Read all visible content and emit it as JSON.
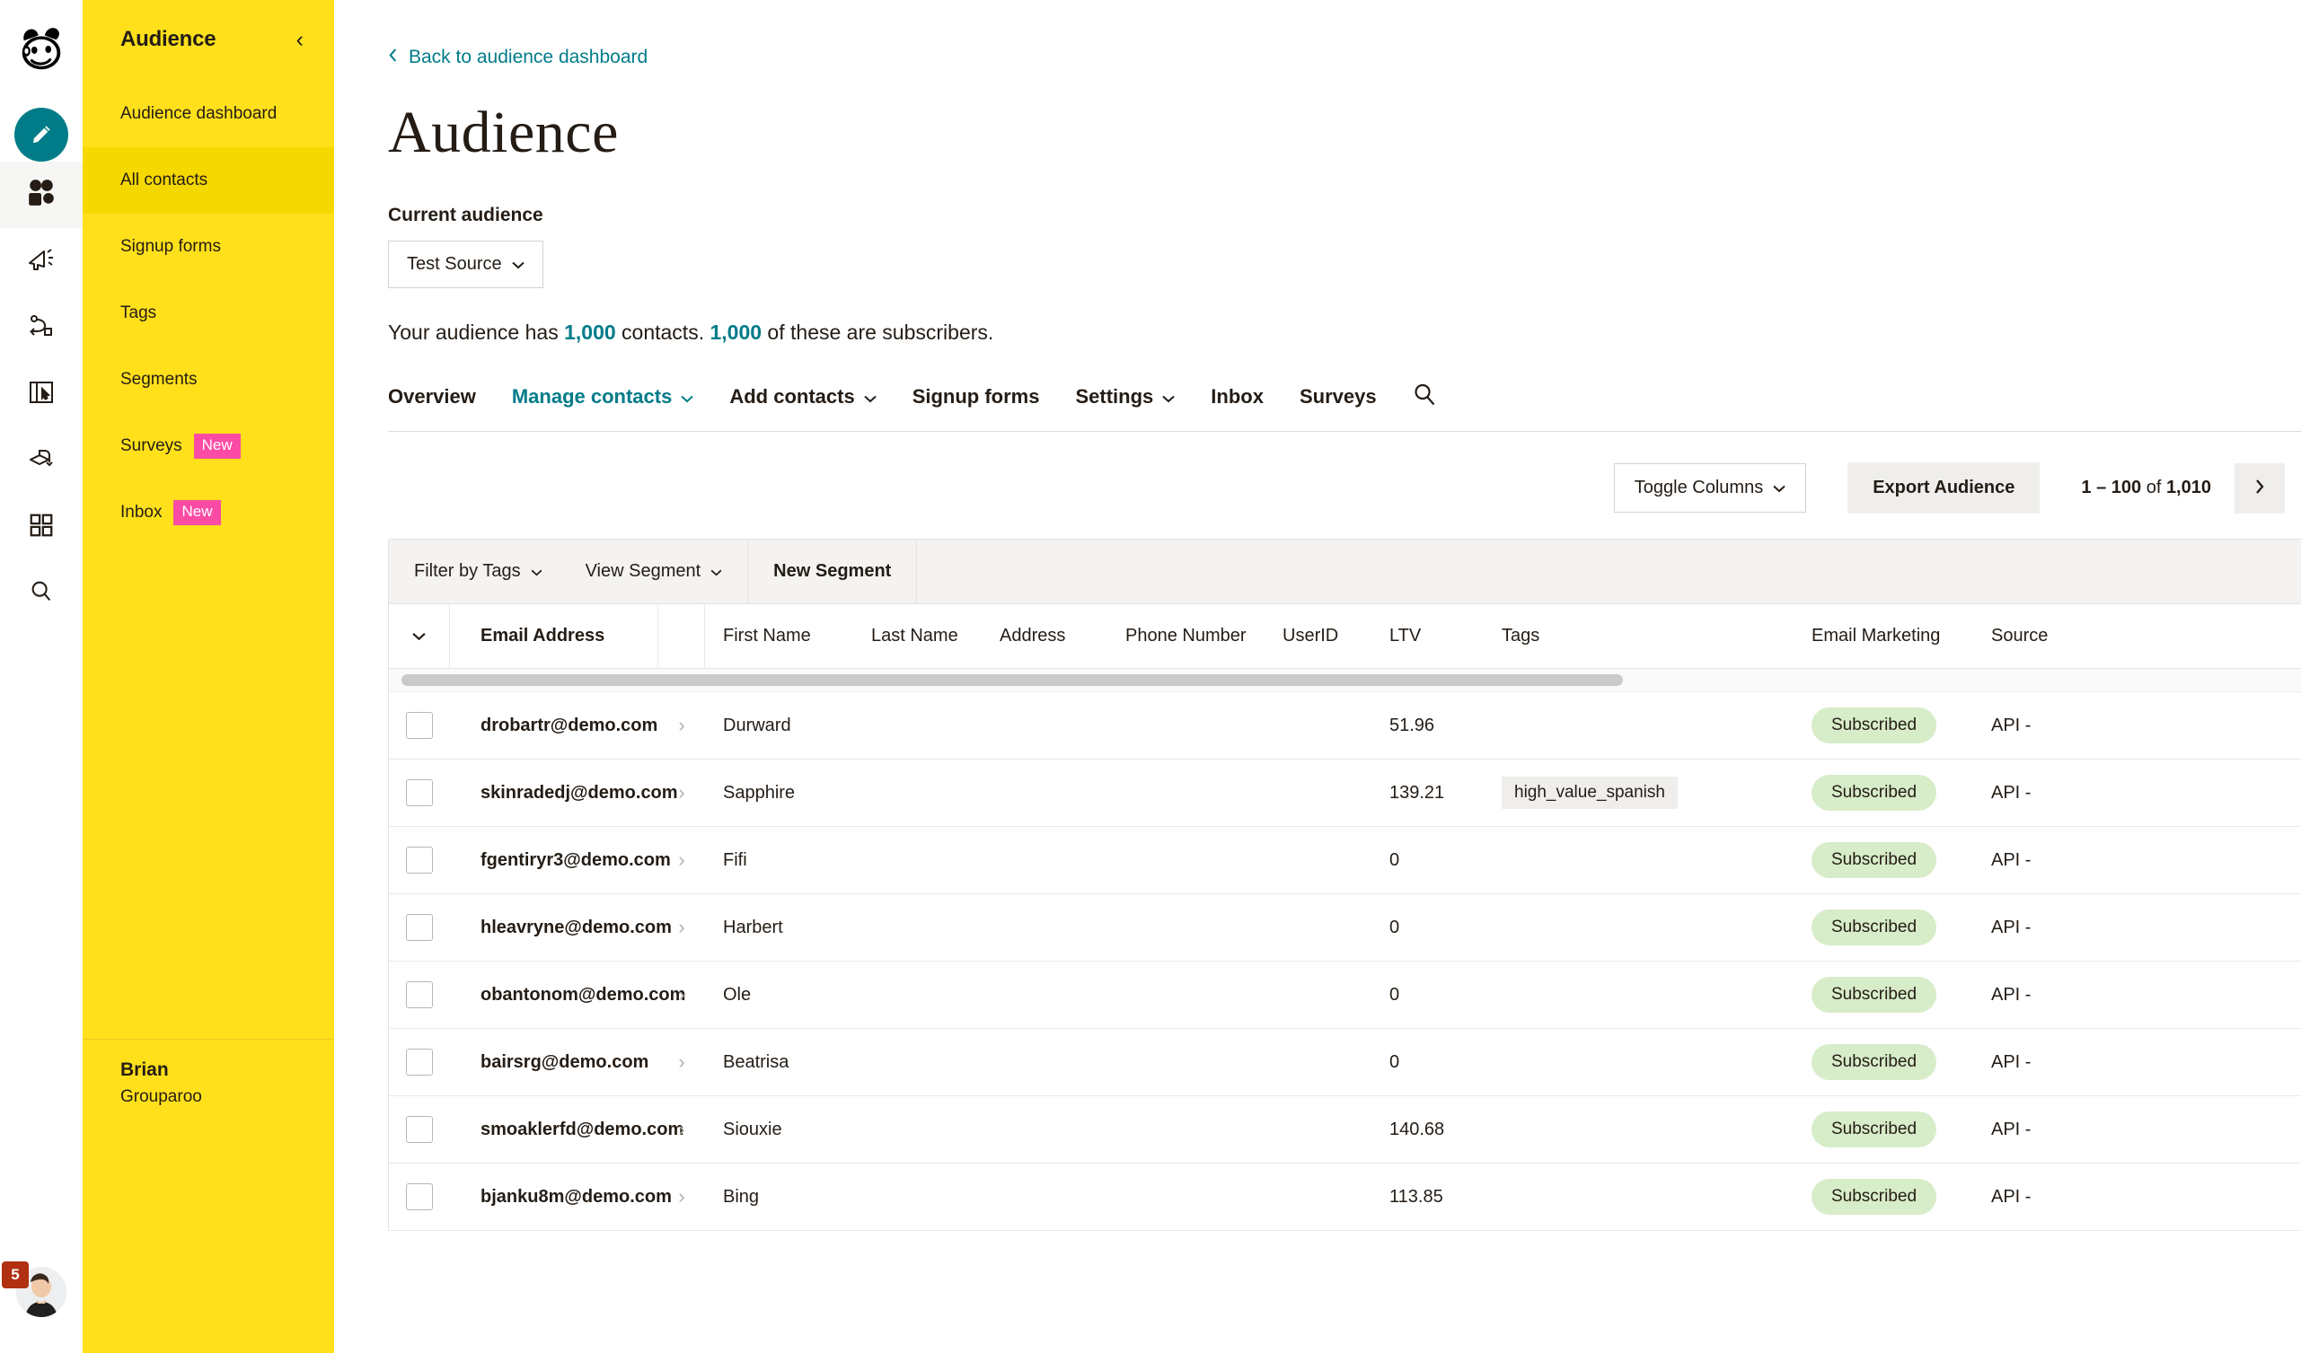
{
  "rail": {
    "logo_icon": "mailchimp-freddie-logo",
    "compose_icon": "pencil-icon",
    "items": [
      {
        "icon": "contacts-icon",
        "name": "all-contacts",
        "active": true
      },
      {
        "icon": "megaphone-icon",
        "name": "signup-forms",
        "active": false
      },
      {
        "icon": "journey-icon",
        "name": "tags",
        "active": false
      },
      {
        "icon": "segments-icon",
        "name": "segments",
        "active": false
      },
      {
        "icon": "surveys-icon",
        "name": "surveys",
        "active": false
      },
      {
        "icon": "grid-icon",
        "name": "inbox",
        "active": false
      },
      {
        "icon": "search-icon",
        "name": "search",
        "active": false
      }
    ],
    "avatar_badge": "5"
  },
  "nav": {
    "title": "Audience",
    "collapse_icon": "chevron-left-icon",
    "items": [
      {
        "label": "Audience dashboard",
        "badge": "",
        "active": false
      },
      {
        "label": "All contacts",
        "badge": "",
        "active": true
      },
      {
        "label": "Signup forms",
        "badge": "",
        "active": false
      },
      {
        "label": "Tags",
        "badge": "",
        "active": false
      },
      {
        "label": "Segments",
        "badge": "",
        "active": false
      },
      {
        "label": "Surveys",
        "badge": "New",
        "active": false
      },
      {
        "label": "Inbox",
        "badge": "New",
        "active": false
      }
    ],
    "user": {
      "name": "Brian",
      "org": "Grouparoo"
    }
  },
  "main": {
    "back_link": "Back to audience dashboard",
    "back_icon": "chevron-left-icon",
    "page_title": "Audience",
    "current_audience_label": "Current audience",
    "source_select": {
      "value": "Test Source",
      "icon": "chevron-down-icon"
    },
    "stats": {
      "prefix": "Your audience has ",
      "contacts_count": "1,000",
      "middle": " contacts. ",
      "subscribers_count": "1,000",
      "suffix": " of these are subscribers."
    },
    "tabs": [
      {
        "label": "Overview",
        "caret": false,
        "active": false
      },
      {
        "label": "Manage contacts",
        "caret": true,
        "active": true
      },
      {
        "label": "Add contacts",
        "caret": true,
        "active": false
      },
      {
        "label": "Signup forms",
        "caret": false,
        "active": false
      },
      {
        "label": "Settings",
        "caret": true,
        "active": false
      },
      {
        "label": "Inbox",
        "caret": false,
        "active": false
      },
      {
        "label": "Surveys",
        "caret": false,
        "active": false
      }
    ],
    "tab_search_icon": "search-icon",
    "toolbar": {
      "toggle_columns": "Toggle Columns",
      "toggle_columns_icon": "chevron-down-icon",
      "export_audience": "Export Audience",
      "pager_range": "1 – 100",
      "pager_of": " of ",
      "pager_total": "1,010",
      "pager_next_icon": "chevron-right-icon"
    }
  },
  "table": {
    "filters": [
      {
        "label": "Filter by Tags",
        "caret": true,
        "bold": false
      },
      {
        "label": "View Segment",
        "caret": true,
        "bold": false
      },
      {
        "label": "New Segment",
        "caret": false,
        "bold": true
      }
    ],
    "select_all_icon": "chevron-down-icon",
    "columns": [
      "Email Address",
      "First Name",
      "Last Name",
      "Address",
      "Phone Number",
      "UserID",
      "LTV",
      "Tags",
      "Email Marketing",
      "Source"
    ],
    "rows": [
      {
        "email": "drobartr@demo.com",
        "first_name": "Durward",
        "last_name": "",
        "address": "",
        "phone": "",
        "userid": "",
        "ltv": "51.96",
        "tags": "",
        "email_marketing": "Subscribed",
        "source": "API -"
      },
      {
        "email": "skinradedj@demo.com",
        "first_name": "Sapphire",
        "last_name": "",
        "address": "",
        "phone": "",
        "userid": "",
        "ltv": "139.21",
        "tags": "high_value_spanish",
        "email_marketing": "Subscribed",
        "source": "API -"
      },
      {
        "email": "fgentiryr3@demo.com",
        "first_name": "Fifi",
        "last_name": "",
        "address": "",
        "phone": "",
        "userid": "",
        "ltv": "0",
        "tags": "",
        "email_marketing": "Subscribed",
        "source": "API -"
      },
      {
        "email": "hleavryne@demo.com",
        "first_name": "Harbert",
        "last_name": "",
        "address": "",
        "phone": "",
        "userid": "",
        "ltv": "0",
        "tags": "",
        "email_marketing": "Subscribed",
        "source": "API -"
      },
      {
        "email": "obantonom@demo.com",
        "first_name": "Ole",
        "last_name": "",
        "address": "",
        "phone": "",
        "userid": "",
        "ltv": "0",
        "tags": "",
        "email_marketing": "Subscribed",
        "source": "API -"
      },
      {
        "email": "bairsrg@demo.com",
        "first_name": "Beatrisa",
        "last_name": "",
        "address": "",
        "phone": "",
        "userid": "",
        "ltv": "0",
        "tags": "",
        "email_marketing": "Subscribed",
        "source": "API -"
      },
      {
        "email": "smoaklerfd@demo.com",
        "first_name": "Siouxie",
        "last_name": "",
        "address": "",
        "phone": "",
        "userid": "",
        "ltv": "140.68",
        "tags": "",
        "email_marketing": "Subscribed",
        "source": "API -"
      },
      {
        "email": "bjanku8m@demo.com",
        "first_name": "Bing",
        "last_name": "",
        "address": "",
        "phone": "",
        "userid": "",
        "ltv": "113.85",
        "tags": "",
        "email_marketing": "Subscribed",
        "source": "API -"
      }
    ],
    "row_arrow_icon": "chevron-right-icon"
  },
  "colors": {
    "brand_yellow": "#ffe01b",
    "active_yellow": "#f5d800",
    "teal": "#007c89",
    "pink_badge": "#fc4ba4",
    "subscribed_green": "#d7ecc8",
    "badge_red": "#b03011"
  }
}
